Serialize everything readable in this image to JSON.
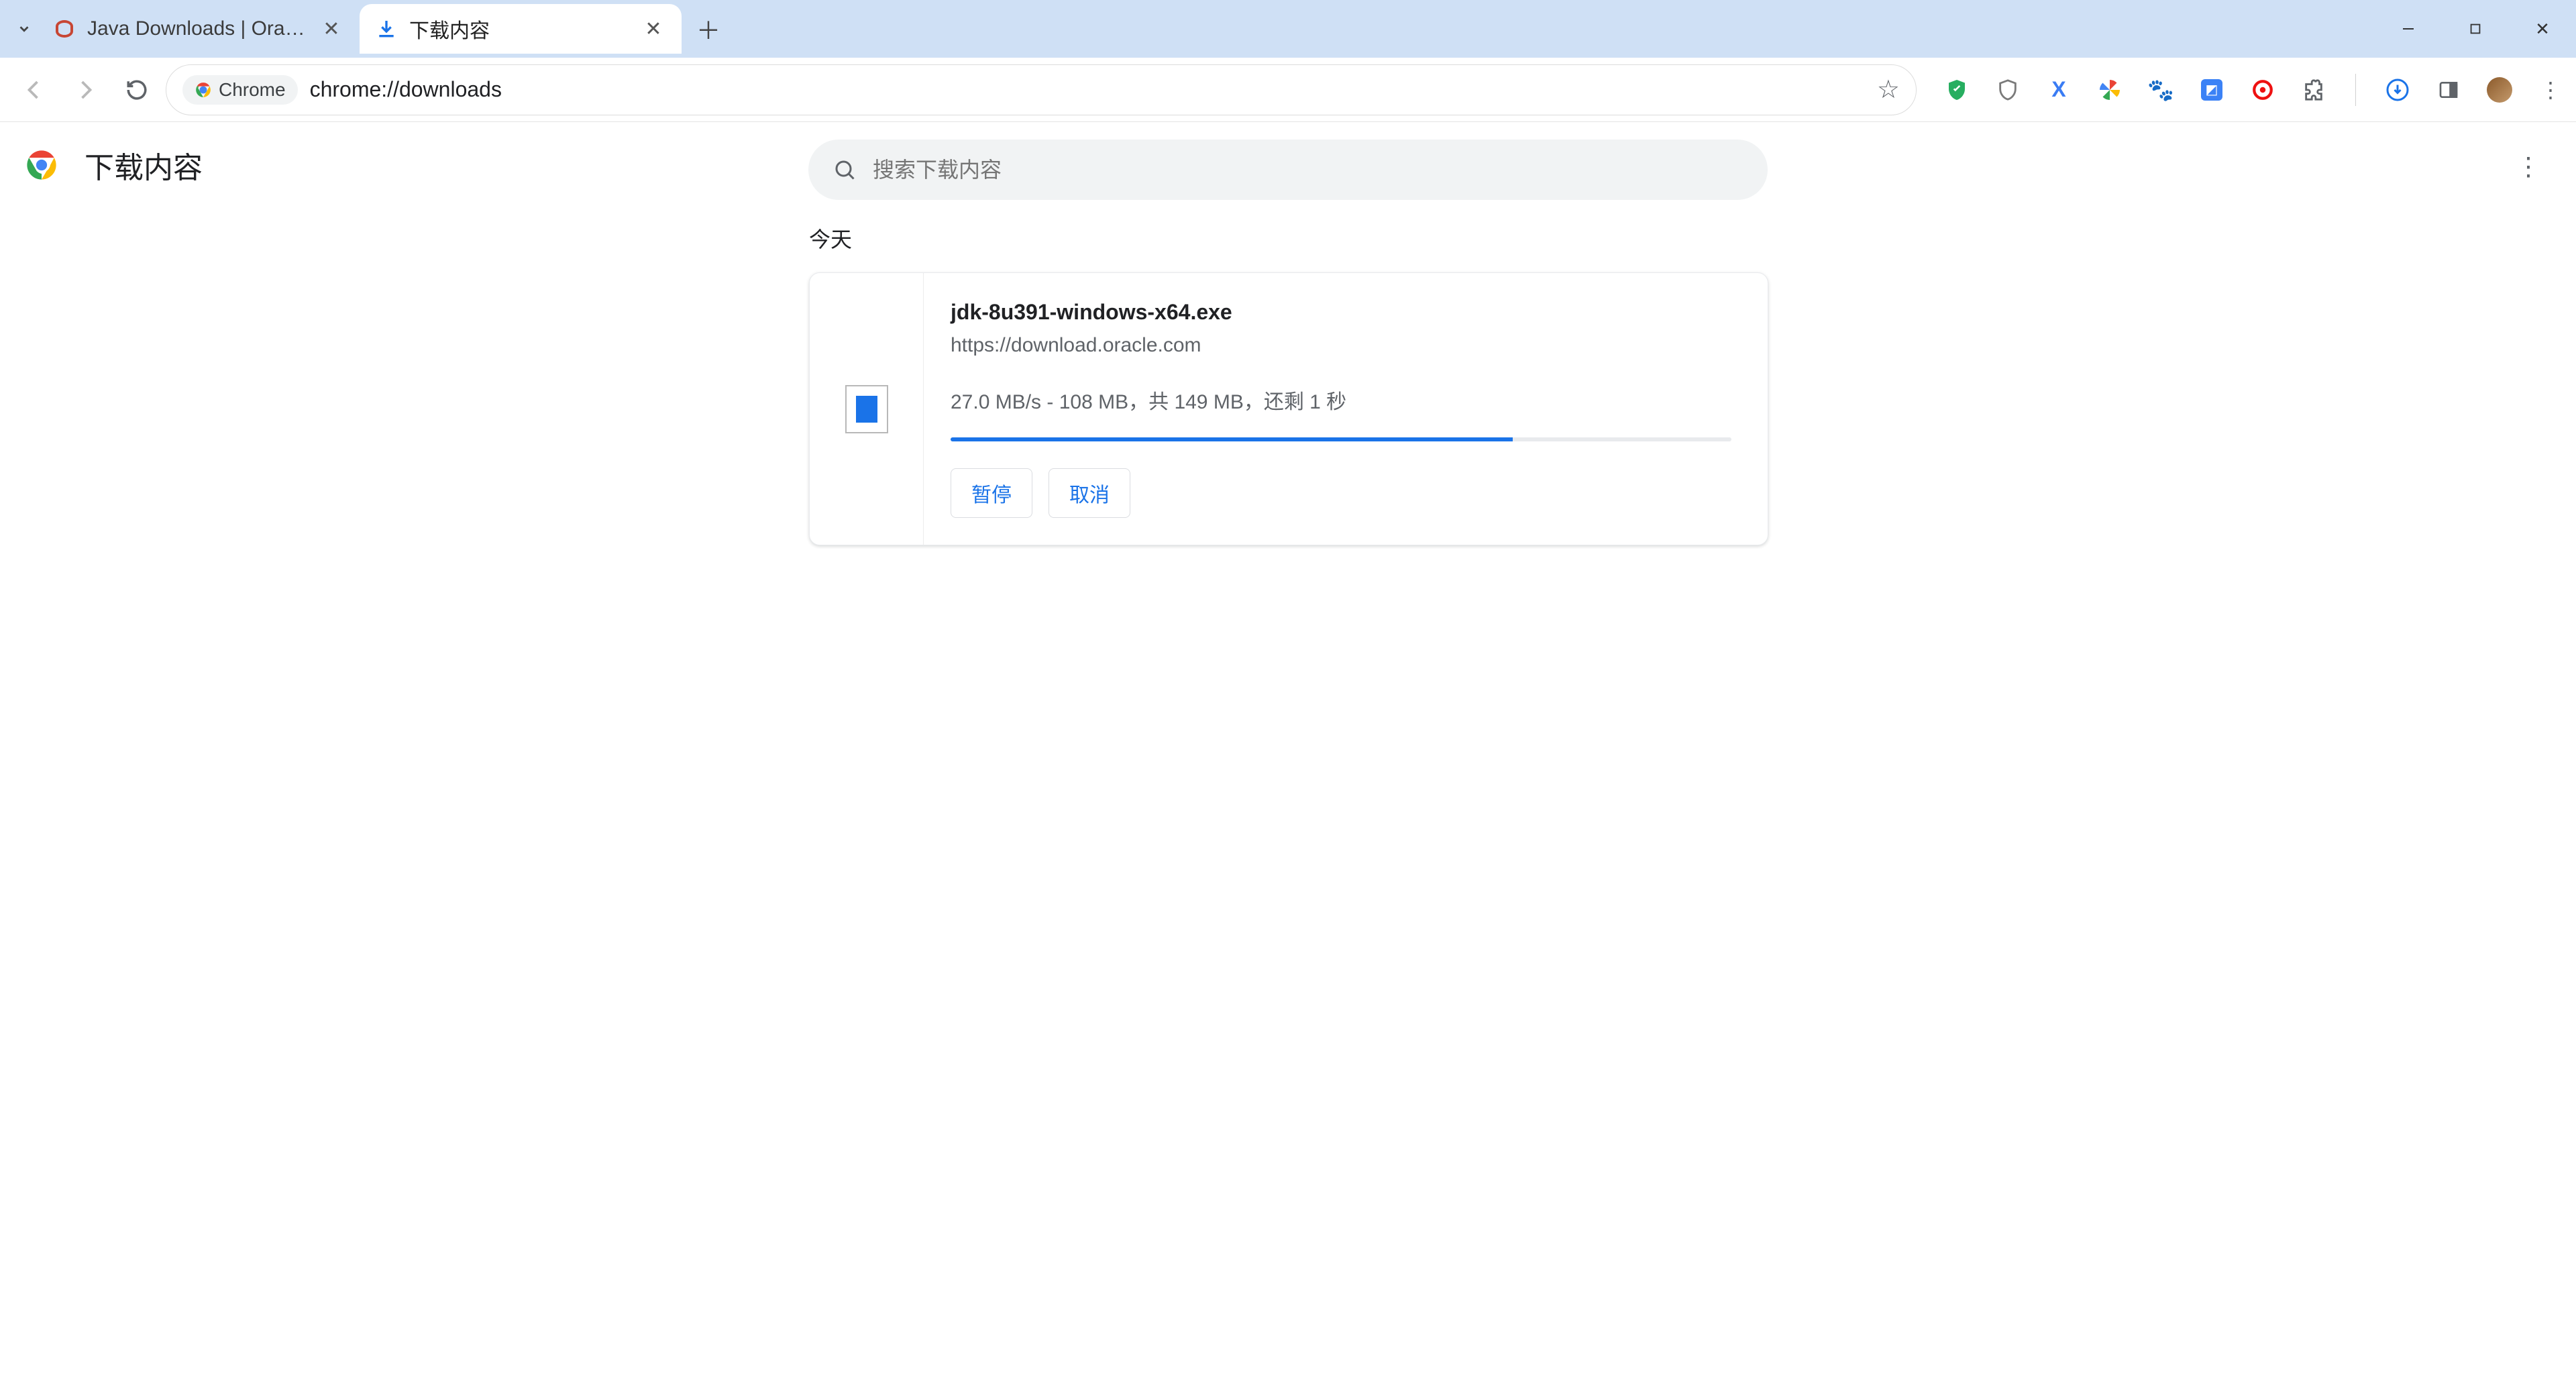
{
  "tabs": [
    {
      "title": "Java Downloads | Oracle",
      "active": false
    },
    {
      "title": "下载内容",
      "active": true
    }
  ],
  "omnibox": {
    "chip_label": "Chrome",
    "url": "chrome://downloads"
  },
  "page": {
    "title": "下载内容",
    "search_placeholder": "搜索下载内容",
    "section_today": "今天"
  },
  "download": {
    "filename": "jdk-8u391-windows-x64.exe",
    "source": "https://download.oracle.com",
    "status": "27.0 MB/s - 108 MB，共 149 MB，还剩 1 秒",
    "progress_percent": 72,
    "btn_pause": "暂停",
    "btn_cancel": "取消"
  }
}
